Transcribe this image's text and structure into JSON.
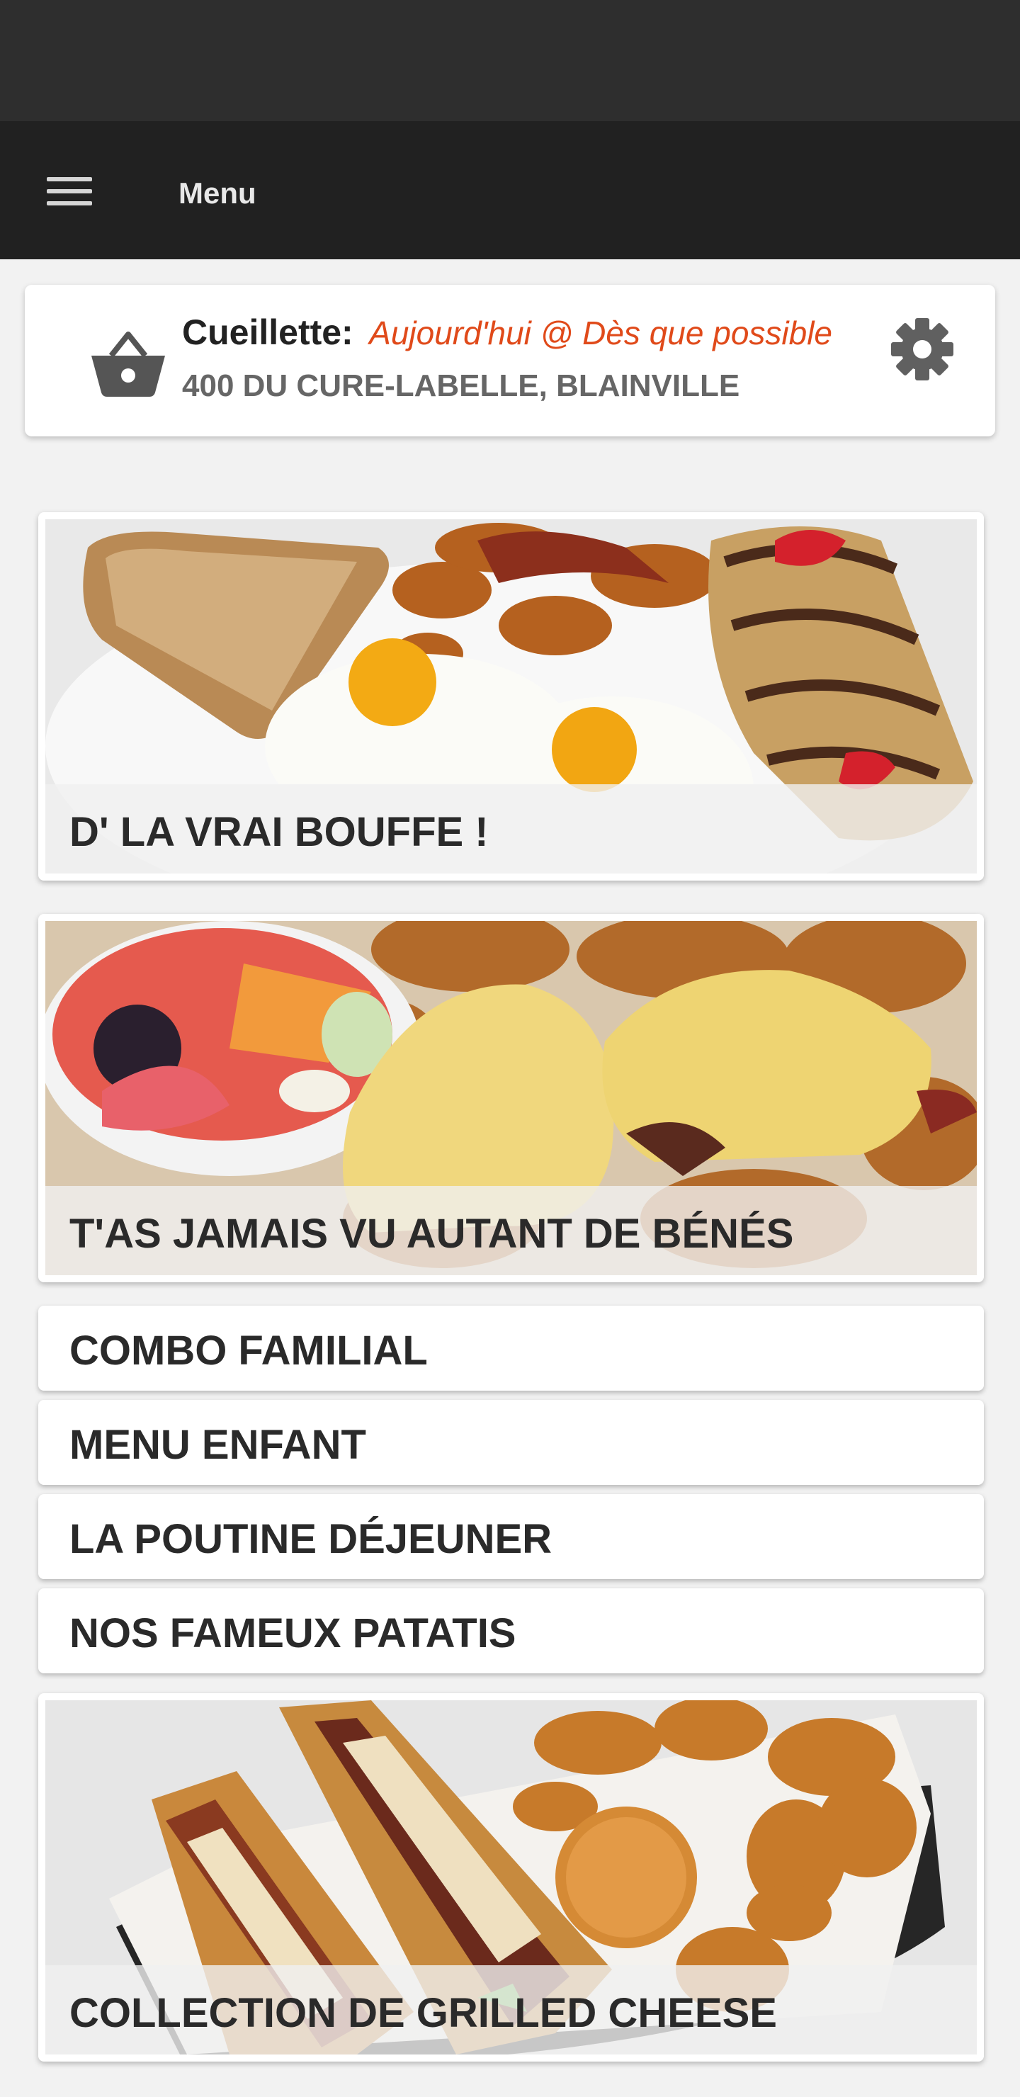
{
  "app_bar": {
    "title": "Menu",
    "menu_icon": "hamburger-menu-icon"
  },
  "pickup": {
    "label": "Cueillette:",
    "time": "Aujourd'hui @ Dès que possible",
    "address": "400 DU CURE-LABELLE, BLAINVILLE",
    "icons": {
      "basket": "shopping-basket-icon",
      "settings": "gear-icon"
    }
  },
  "categories": [
    {
      "label": "D' LA VRAI BOUFFE !",
      "image": "breakfast-plate-eggs-toast-crepe"
    },
    {
      "label": "T'AS JAMAIS VU AUTANT DE BÉNÉS",
      "image": "eggs-benedict-fruit-bowl"
    },
    {
      "label": "COMBO FAMILIAL"
    },
    {
      "label": "MENU ENFANT"
    },
    {
      "label": "LA POUTINE DÉJEUNER"
    },
    {
      "label": "NOS FAMEUX PATATIS"
    },
    {
      "label": "COLLECTION DE GRILLED CHEESE",
      "image": "grilled-cheese-potatoes-basket"
    }
  ],
  "colors": {
    "accent": "#e04a1a",
    "app_bar": "#212121",
    "status_bar": "#2e2e2e"
  }
}
